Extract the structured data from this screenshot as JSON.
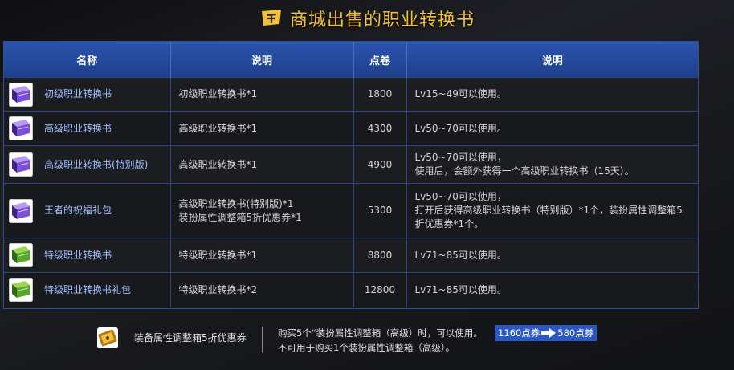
{
  "header": {
    "title": "商城出售的职业转换书"
  },
  "table": {
    "columns": [
      "名称",
      "说明",
      "点卷",
      "说明"
    ],
    "rows": [
      {
        "icon": "purple-book-icon",
        "name": "初级职业转换书",
        "desc": [
          "初级职业转换书*1"
        ],
        "price": "1800",
        "note": [
          "Lv15~49可以使用。"
        ]
      },
      {
        "icon": "purple-book-icon",
        "name": "高级职业转换书",
        "desc": [
          "高级职业转换书*1"
        ],
        "price": "4300",
        "note": [
          "Lv50~70可以使用。"
        ]
      },
      {
        "icon": "purple-book-icon",
        "name": "高级职业转换书(特别版)",
        "desc": [
          "高级职业转换书*1"
        ],
        "price": "4900",
        "note": [
          "Lv50~70可以使用，",
          "使用后，会额外获得一个高级职业转换书（15天）。"
        ]
      },
      {
        "icon": "purple-book-icon",
        "name": "王者的祝福礼包",
        "desc": [
          "高级职业转换书(特别版)*1",
          "装扮属性调整箱5折优惠券*1"
        ],
        "price": "5300",
        "note": [
          "Lv50~70可以使用，",
          "打开后获得高级职业转换书（特别版）*1个，装扮属性调整箱5",
          "折优惠券*1个。"
        ]
      },
      {
        "icon": "green-book-icon",
        "name": "特级职业转换书",
        "desc": [
          "特级职业转换书*1"
        ],
        "price": "8800",
        "note": [
          "Lv71~85可以使用。"
        ]
      },
      {
        "icon": "green-book-icon",
        "name": "特级职业转换书礼包",
        "desc": [
          "特级职业转换书*2"
        ],
        "price": "12800",
        "note": [
          "Lv71~85可以使用。"
        ]
      }
    ]
  },
  "coupon": {
    "icon": "coupon-ticket-icon",
    "name": "装备属性调整箱5折优惠券",
    "desc_line1": "购买5个“装扮属性调整箱（高级）时，可以使用。",
    "desc_line2": "不可用于购买1个装扮属性调整箱（高级）。",
    "price_from": "1160点券",
    "price_to": "580点券"
  }
}
